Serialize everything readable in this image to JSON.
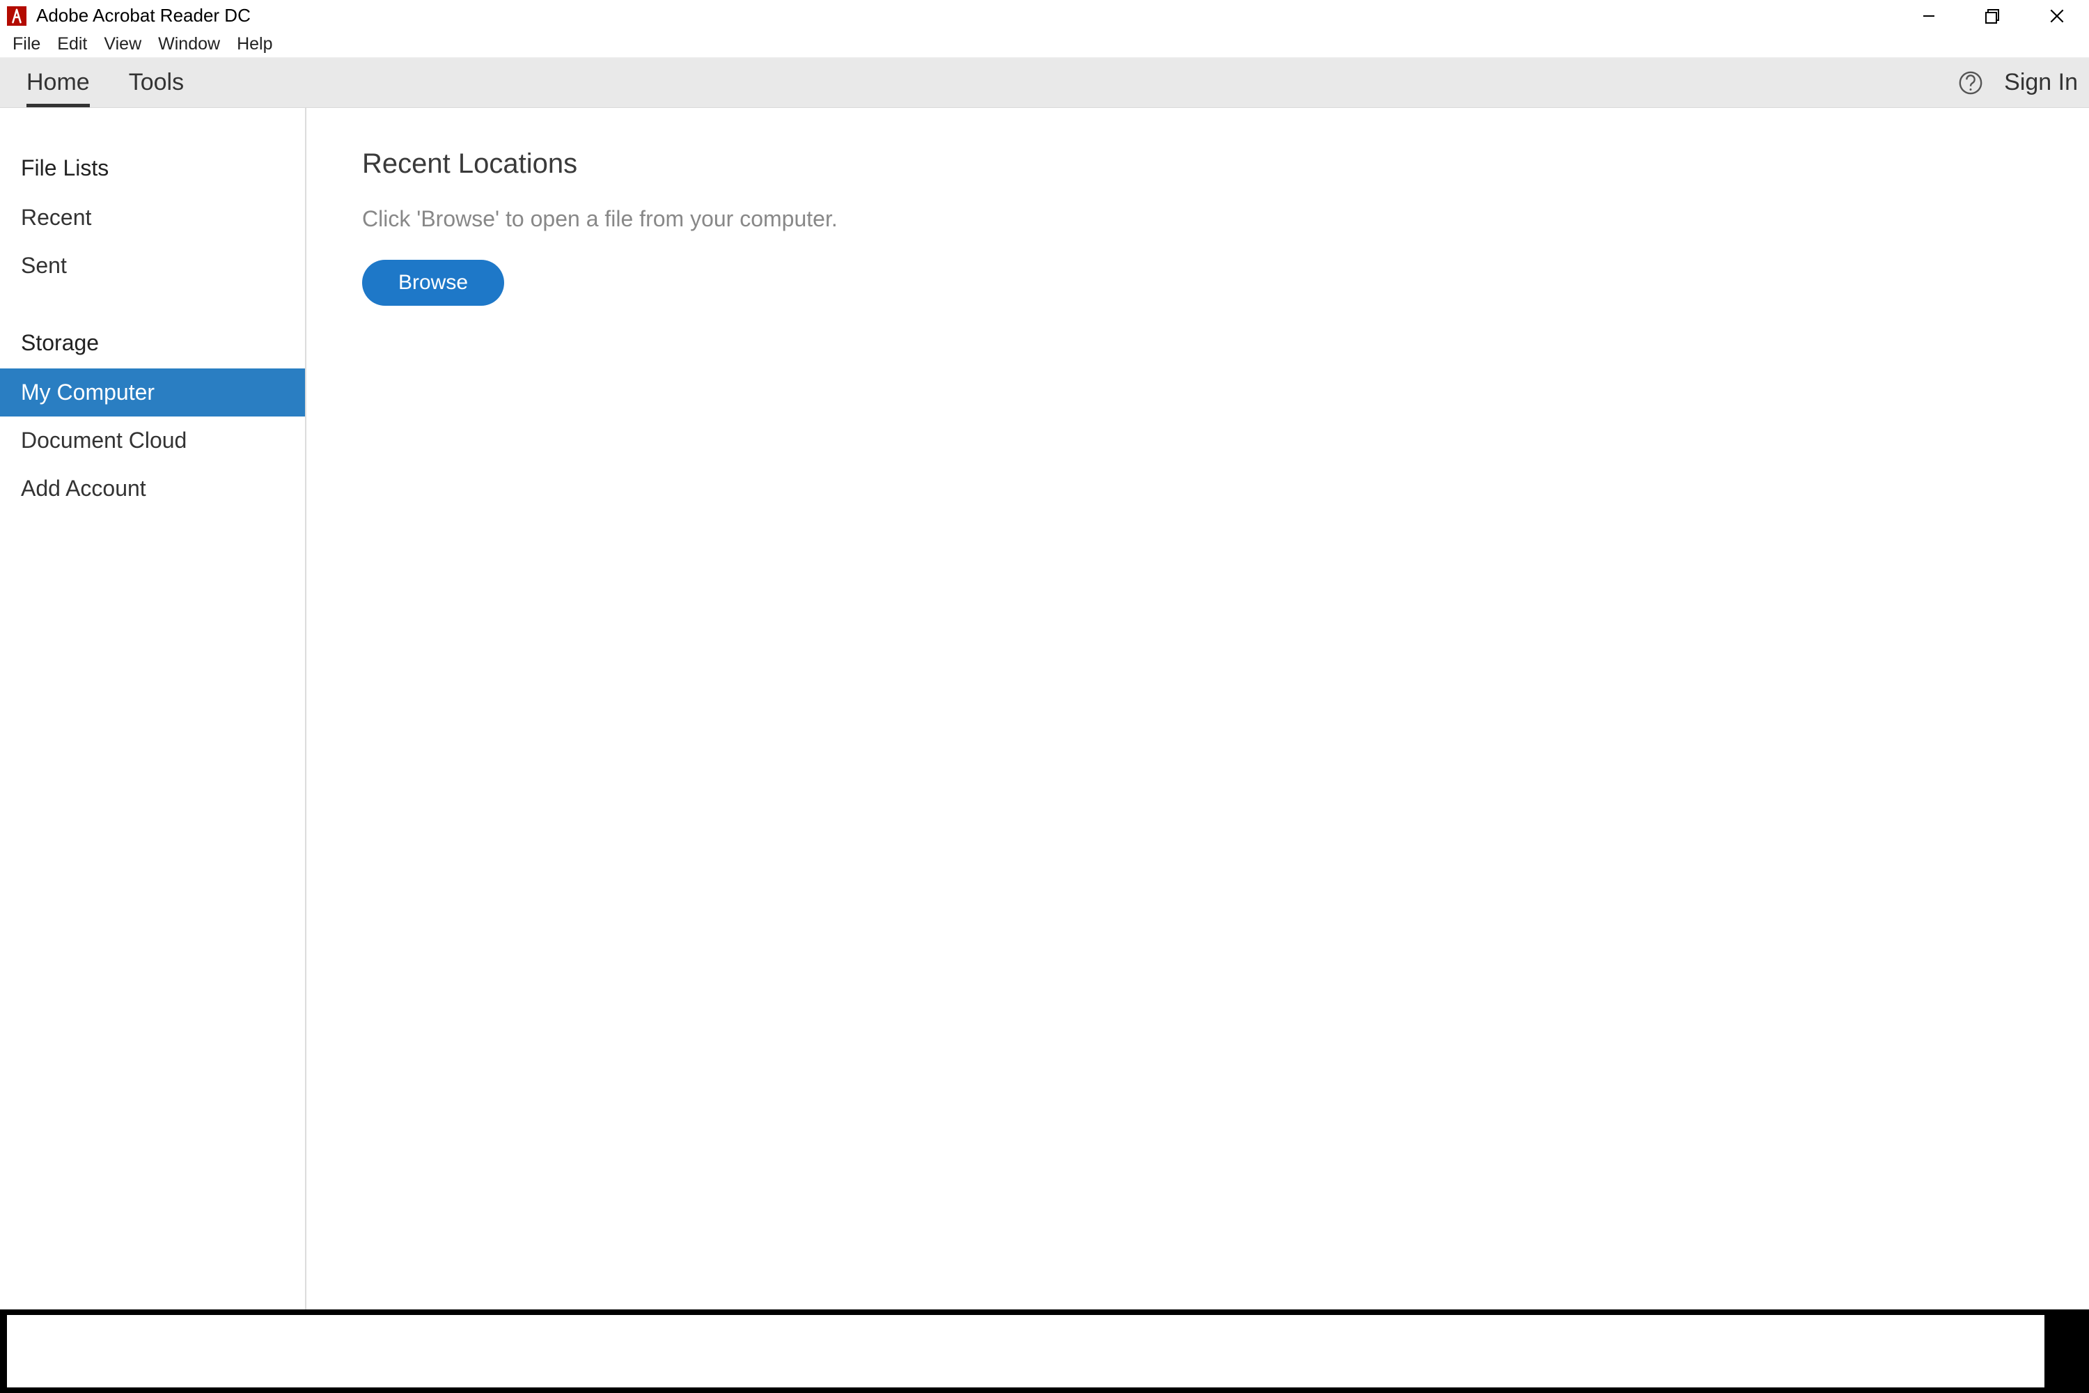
{
  "app": {
    "title": "Adobe Acrobat Reader DC"
  },
  "menubar": {
    "items": [
      "File",
      "Edit",
      "View",
      "Window",
      "Help"
    ]
  },
  "toolbar": {
    "tabs": [
      "Home",
      "Tools"
    ],
    "active": "Home",
    "signin": "Sign In"
  },
  "sidebar": {
    "sections": [
      {
        "header": "File Lists",
        "items": [
          "Recent",
          "Sent"
        ]
      },
      {
        "header": "Storage",
        "items": [
          "My Computer",
          "Document Cloud",
          "Add Account"
        ],
        "selected": "My Computer"
      }
    ]
  },
  "content": {
    "heading": "Recent Locations",
    "subtext": "Click 'Browse' to open a file from your computer.",
    "browse_label": "Browse"
  }
}
